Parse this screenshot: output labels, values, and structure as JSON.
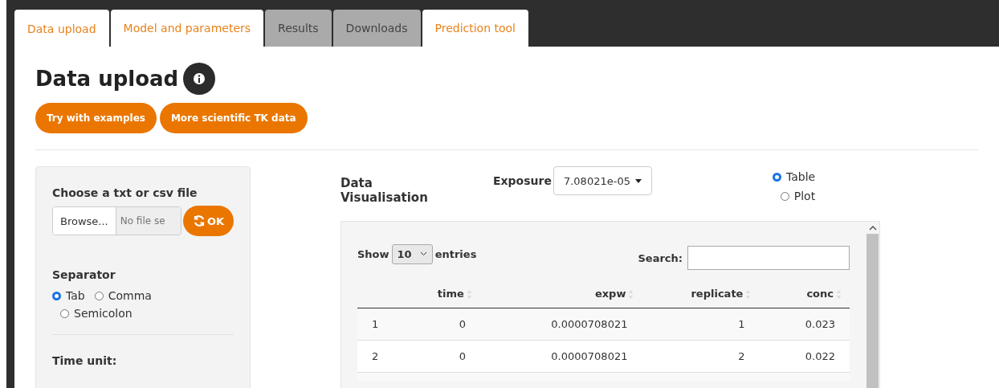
{
  "tabs": [
    {
      "label": "Data upload",
      "selected": true,
      "disabled": false
    },
    {
      "label": "Model and parameters",
      "selected": false,
      "disabled": false
    },
    {
      "label": "Results",
      "selected": false,
      "disabled": true
    },
    {
      "label": "Downloads",
      "selected": false,
      "disabled": true
    },
    {
      "label": "Prediction tool",
      "selected": false,
      "disabled": false
    }
  ],
  "page_title": "Data upload",
  "buttons": [
    "Try with examples",
    "More scientific TK data"
  ],
  "sidebar": {
    "file_label": "Choose a txt or csv file",
    "browse": "Browse...",
    "file_placeholder": "No file se",
    "ok": "OK",
    "separator_label": "Separator",
    "separators": [
      {
        "label": "Tab",
        "selected": true
      },
      {
        "label": "Comma",
        "selected": false
      },
      {
        "label": "Semicolon",
        "selected": false
      }
    ],
    "time_unit_label": "Time unit:"
  },
  "visualisation": {
    "title": "Data Visualisation",
    "exposure_label": "Exposure",
    "exposure_value": "7.08021e-05",
    "views": [
      {
        "label": "Table",
        "selected": true
      },
      {
        "label": "Plot",
        "selected": false
      }
    ]
  },
  "table": {
    "show": "Show",
    "page_size": "10",
    "entries": "entries",
    "search_label": "Search:",
    "columns": [
      "",
      "time",
      "expw",
      "replicate",
      "conc"
    ],
    "rows": [
      [
        "1",
        "0",
        "0.0000708021",
        "1",
        "0.023"
      ],
      [
        "2",
        "0",
        "0.0000708021",
        "2",
        "0.022"
      ]
    ]
  }
}
